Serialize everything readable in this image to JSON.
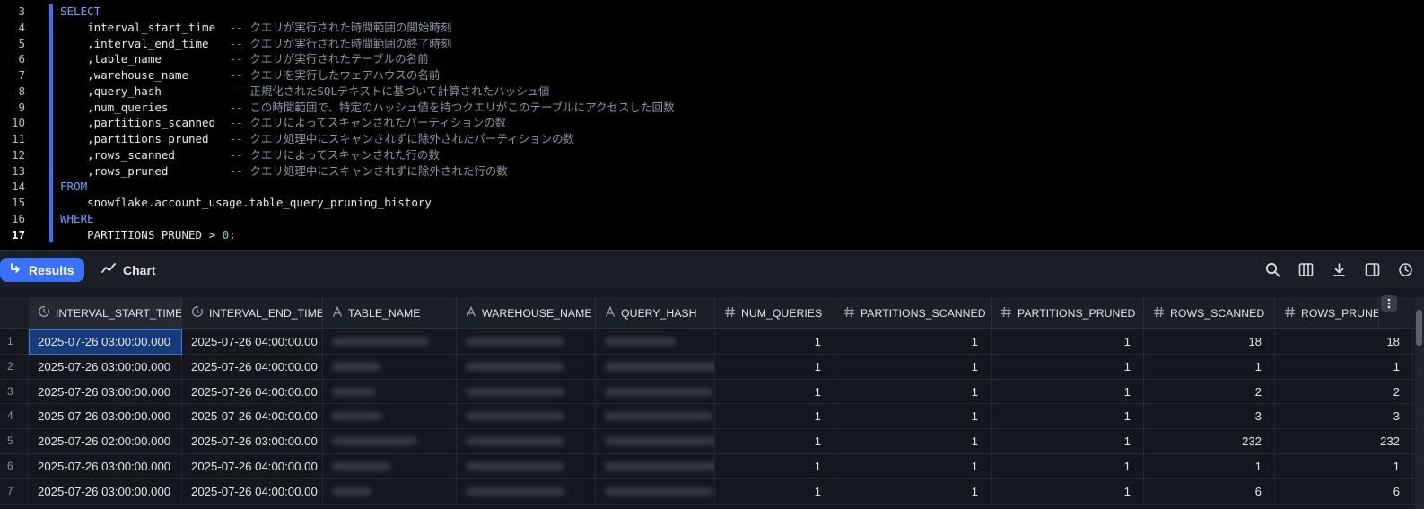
{
  "editor": {
    "line_numbers": [
      "3",
      "4",
      "5",
      "6",
      "7",
      "8",
      "9",
      "10",
      "11",
      "12",
      "13",
      "14",
      "15",
      "16",
      "17"
    ],
    "lines": [
      {
        "kw": "SELECT",
        "code": "",
        "comment": "",
        "pad": 0
      },
      {
        "kw": "",
        "code": "    interval_start_time",
        "comment": "-- クエリが実行された時間範囲の開始時刻",
        "pad": 25
      },
      {
        "kw": "",
        "code": "    ,interval_end_time",
        "comment": "-- クエリが実行された時間範囲の終了時刻",
        "pad": 25
      },
      {
        "kw": "",
        "code": "    ,table_name",
        "comment": "-- クエリが実行されたテーブルの名前",
        "pad": 25
      },
      {
        "kw": "",
        "code": "    ,warehouse_name",
        "comment": "-- クエリを実行したウェアハウスの名前",
        "pad": 25
      },
      {
        "kw": "",
        "code": "    ,query_hash",
        "comment": "-- 正規化されたSQLテキストに基づいて計算されたハッシュ値",
        "pad": 25
      },
      {
        "kw": "",
        "code": "    ,num_queries",
        "comment": "-- この時間範囲で、特定のハッシュ値を持つクエリがこのテーブルにアクセスした回数",
        "pad": 25
      },
      {
        "kw": "",
        "code": "    ,partitions_scanned",
        "comment": "-- クエリによってスキャンされたパーティションの数",
        "pad": 25
      },
      {
        "kw": "",
        "code": "    ,partitions_pruned",
        "comment": "-- クエリ処理中にスキャンされずに除外されたパーティションの数",
        "pad": 25
      },
      {
        "kw": "",
        "code": "    ,rows_scanned",
        "comment": "-- クエリによってスキャンされた行の数",
        "pad": 25
      },
      {
        "kw": "",
        "code": "    ,rows_pruned",
        "comment": "-- クエリ処理中にスキャンされずに除外された行の数",
        "pad": 25
      },
      {
        "kw": "FROM",
        "code": "",
        "comment": "",
        "pad": 0
      },
      {
        "kw": "",
        "code": "    snowflake.account_usage.table_query_pruning_history",
        "comment": "",
        "pad": 0
      },
      {
        "kw": "WHERE",
        "code": "",
        "comment": "",
        "pad": 0
      },
      {
        "kw": "",
        "code": "    PARTITIONS_PRUNED > ",
        "comment": "",
        "pad": 0,
        "num": "0",
        "tail": ";"
      }
    ]
  },
  "tabs": {
    "results_label": "Results",
    "chart_label": "Chart"
  },
  "toolbar_icons": [
    "search-icon",
    "columns-icon",
    "download-icon",
    "split-view-icon",
    "history-icon"
  ],
  "grid": {
    "columns": [
      {
        "label": "INTERVAL_START_TIME",
        "type_icon": "clock-icon"
      },
      {
        "label": "INTERVAL_END_TIME",
        "type_icon": "clock-icon"
      },
      {
        "label": "TABLE_NAME",
        "type_icon": "text-type-icon"
      },
      {
        "label": "WAREHOUSE_NAME",
        "type_icon": "text-type-icon"
      },
      {
        "label": "QUERY_HASH",
        "type_icon": "text-type-icon"
      },
      {
        "label": "NUM_QUERIES",
        "type_icon": "number-type-icon"
      },
      {
        "label": "PARTITIONS_SCANNED",
        "type_icon": "number-type-icon"
      },
      {
        "label": "PARTITIONS_PRUNED",
        "type_icon": "number-type-icon"
      },
      {
        "label": "ROWS_SCANNED",
        "type_icon": "number-type-icon"
      },
      {
        "label": "ROWS_PRUNE",
        "type_icon": "number-type-icon"
      }
    ],
    "rows": [
      {
        "idx": "1",
        "start": "2025-07-26 03:00:00.000",
        "end": "2025-07-26 04:00:00.00",
        "num_queries": "1",
        "p_scanned": "1",
        "p_pruned": "1",
        "r_scanned": "18",
        "r_pruned": "18"
      },
      {
        "idx": "2",
        "start": "2025-07-26 03:00:00.000",
        "end": "2025-07-26 04:00:00.00",
        "num_queries": "1",
        "p_scanned": "1",
        "p_pruned": "1",
        "r_scanned": "1",
        "r_pruned": "1"
      },
      {
        "idx": "3",
        "start": "2025-07-26 03:00:00.000",
        "end": "2025-07-26 04:00:00.00",
        "num_queries": "1",
        "p_scanned": "1",
        "p_pruned": "1",
        "r_scanned": "2",
        "r_pruned": "2"
      },
      {
        "idx": "4",
        "start": "2025-07-26 03:00:00.000",
        "end": "2025-07-26 04:00:00.00",
        "num_queries": "1",
        "p_scanned": "1",
        "p_pruned": "1",
        "r_scanned": "3",
        "r_pruned": "3"
      },
      {
        "idx": "5",
        "start": "2025-07-26 02:00:00.000",
        "end": "2025-07-26 03:00:00.00",
        "num_queries": "1",
        "p_scanned": "1",
        "p_pruned": "1",
        "r_scanned": "232",
        "r_pruned": "232"
      },
      {
        "idx": "6",
        "start": "2025-07-26 03:00:00.000",
        "end": "2025-07-26 04:00:00.00",
        "num_queries": "1",
        "p_scanned": "1",
        "p_pruned": "1",
        "r_scanned": "1",
        "r_pruned": "1"
      },
      {
        "idx": "7",
        "start": "2025-07-26 03:00:00.000",
        "end": "2025-07-26 04:00:00.00",
        "num_queries": "1",
        "p_scanned": "1",
        "p_pruned": "1",
        "r_scanned": "6",
        "r_pruned": "6"
      }
    ]
  },
  "colors": {
    "accent": "#3b71f7",
    "keyword": "#6ea2ff",
    "comment": "#8a95a3",
    "number_literal": "#6fdca0"
  }
}
